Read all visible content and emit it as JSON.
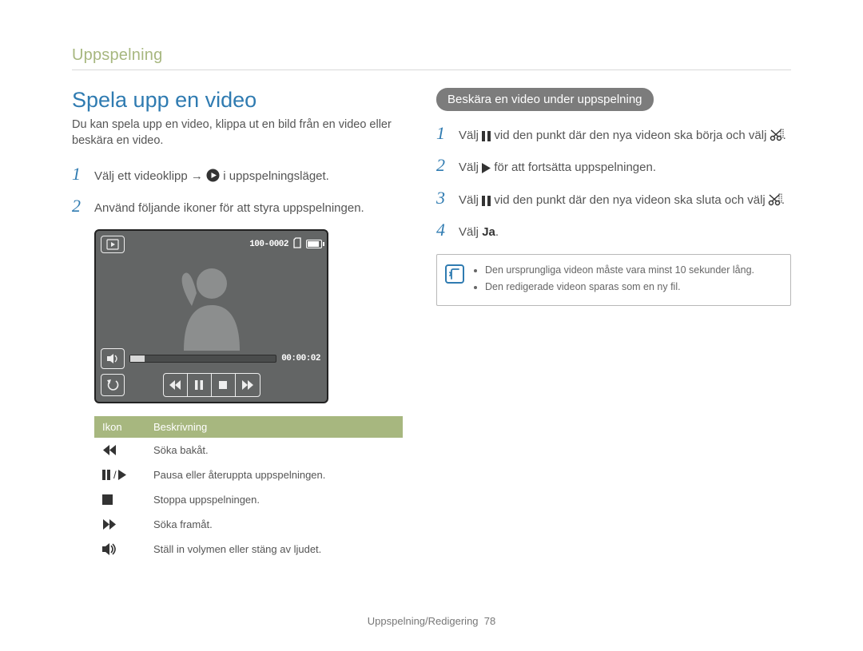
{
  "breadcrumb": "Uppspelning",
  "left": {
    "title": "Spela upp en video",
    "intro": "Du kan spela upp en video, klippa ut en bild från en video eller beskära en video.",
    "step1_a": "Välj ett videoklipp → ",
    "step1_b": " i uppspelningsläget.",
    "step2": "Använd följande ikoner för att styra uppspelningen.",
    "video": {
      "file_counter": "100-0002",
      "time": "00:00:02"
    },
    "table": {
      "h1": "Ikon",
      "h2": "Beskrivning",
      "rows": [
        {
          "desc": "Söka bakåt."
        },
        {
          "desc": "Pausa eller återuppta uppspelningen."
        },
        {
          "desc": "Stoppa uppspelningen."
        },
        {
          "desc": "Söka framåt."
        },
        {
          "desc": "Ställ in volymen eller stäng av ljudet."
        }
      ]
    }
  },
  "right": {
    "pill": "Beskära en video under uppspelning",
    "step1_a": "Välj ",
    "step1_b": " vid den punkt där den nya videon ska börja och välj ",
    "step1_c": ".",
    "step2_a": "Välj ",
    "step2_b": " för att fortsätta uppspelningen.",
    "step3_a": "Välj ",
    "step3_b": " vid den punkt där den nya videon ska sluta och välj ",
    "step3_c": ".",
    "step4_a": "Välj ",
    "step4_b": "Ja",
    "step4_c": ".",
    "note1": "Den ursprungliga videon måste vara minst 10 sekunder lång.",
    "note2": "Den redigerade videon sparas som en ny fil."
  },
  "footer_a": "Uppspelning/Redigering",
  "footer_b": "78"
}
